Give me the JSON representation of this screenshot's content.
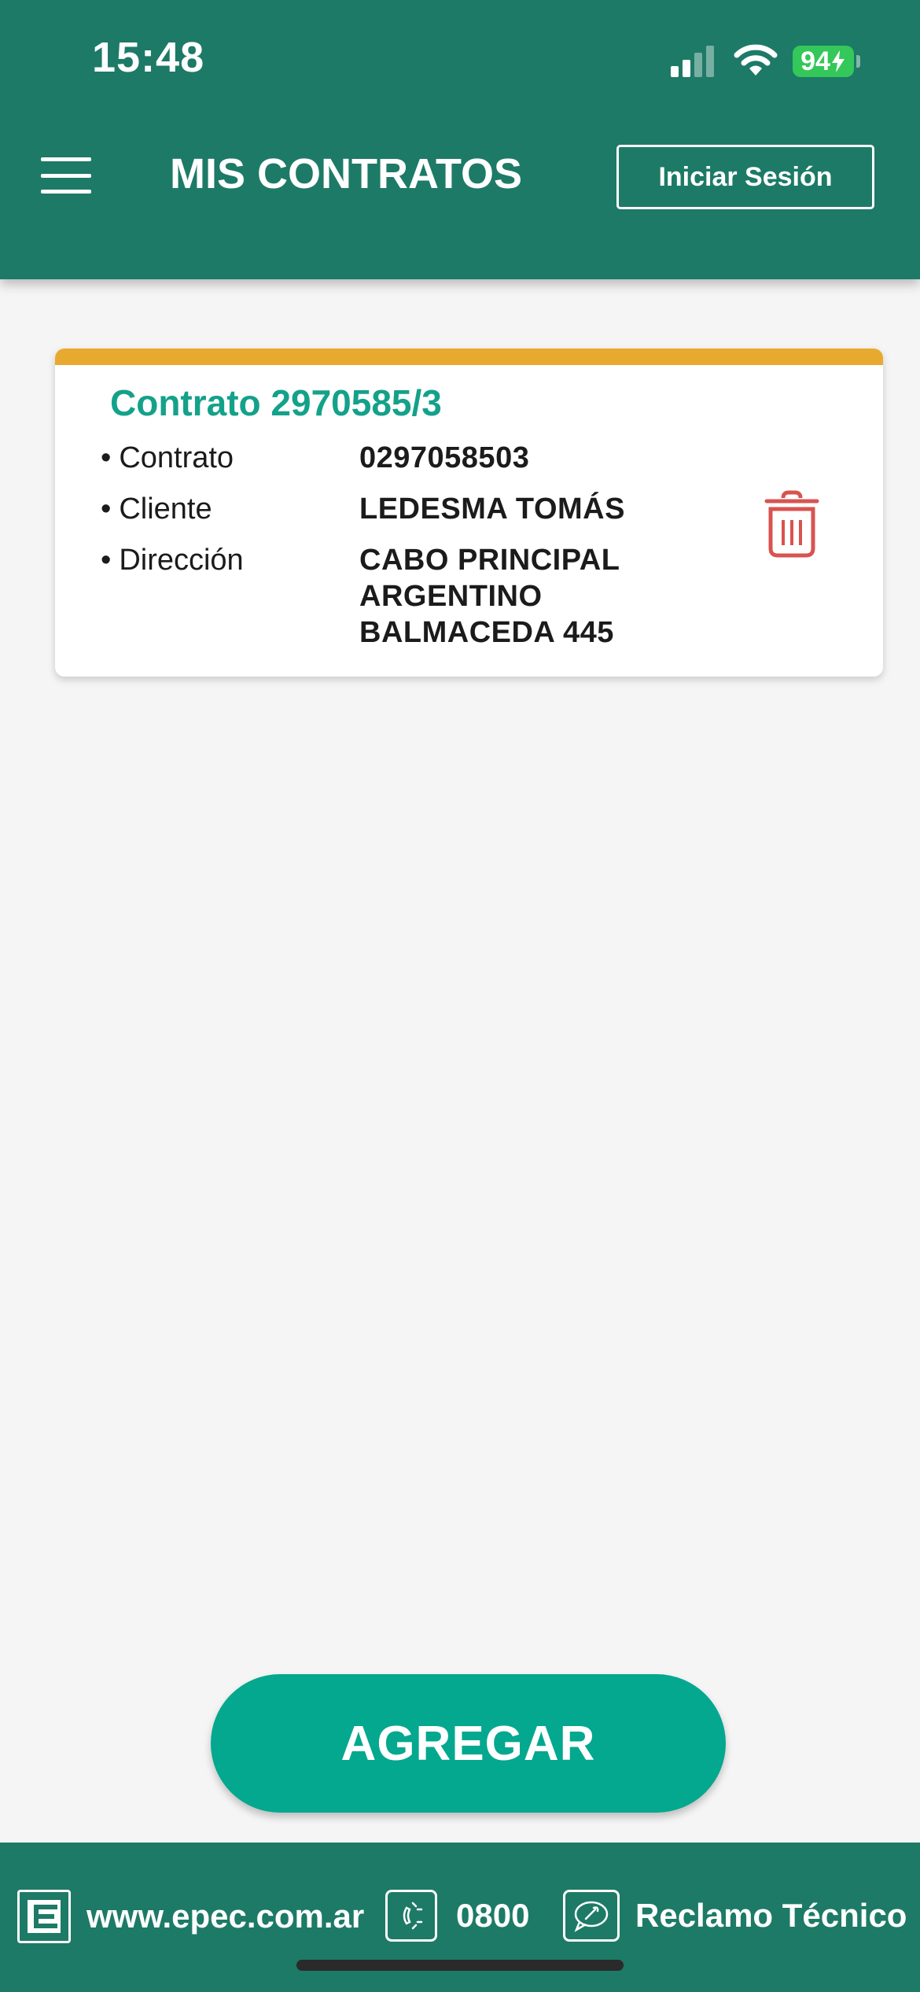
{
  "status_bar": {
    "time": "15:48",
    "battery": "94"
  },
  "header": {
    "title": "MIS CONTRATOS",
    "login_label": "Iniciar Sesión"
  },
  "contract_card": {
    "title": "Contrato 2970585/3",
    "rows": [
      {
        "label": "Contrato",
        "value": "0297058503"
      },
      {
        "label": "Cliente",
        "value": "LEDESMA TOMÁS"
      },
      {
        "label": "Dirección",
        "value_lines": [
          "CABO PRINCIPAL",
          "ARGENTINO",
          "BALMACEDA 445"
        ]
      }
    ]
  },
  "add_button_label": "AGREGAR",
  "footer": {
    "website": "www.epec.com.ar",
    "phone": "0800",
    "claim": "Reclamo Técnico"
  },
  "colors": {
    "primary": "#1d7a67",
    "accent_green": "#14a18a",
    "accent_orange": "#e8aa2e",
    "delete_red": "#d9534f",
    "button": "#03a88f"
  }
}
